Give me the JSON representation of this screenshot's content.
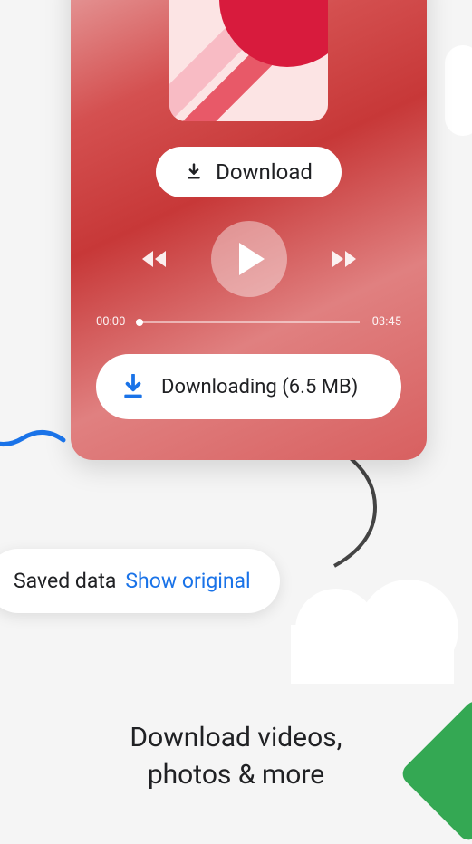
{
  "player": {
    "download_label": "Download",
    "time_current": "00:00",
    "time_total": "03:45",
    "downloading_label": "Downloading (6.5 MB)"
  },
  "saved_data": {
    "label": "Saved data",
    "action": "Show original"
  },
  "hero": {
    "line1": "Download videos,",
    "line2": "photos & more"
  }
}
